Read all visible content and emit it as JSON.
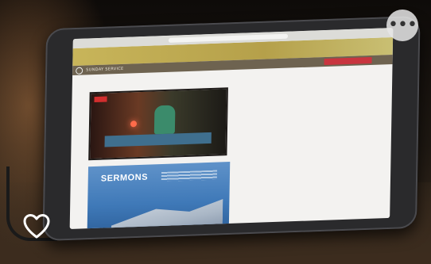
{
  "photo": {
    "description_icon": "tablet-photo",
    "screen": {
      "service_bar_text": "SUNDAY SERVICE",
      "sermons_label": "SERMONS"
    }
  },
  "overlay": {
    "more_label": "•••",
    "heart_icon": "heart-icon"
  },
  "colors": {
    "sermons_blue": "#3f79b8",
    "header_gold": "#c8b55a",
    "cta_red": "#c8353f"
  }
}
